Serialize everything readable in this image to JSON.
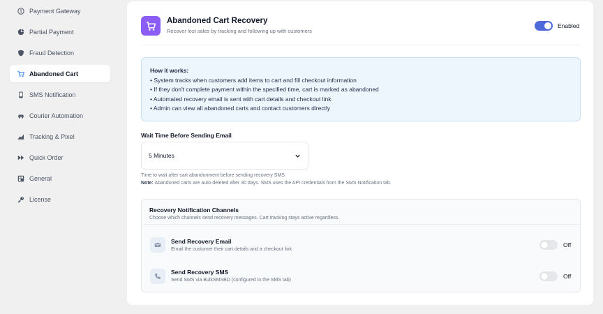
{
  "sidebar": {
    "items": [
      {
        "label": "Payment Gateway",
        "icon": "dollar-icon"
      },
      {
        "label": "Partial Payment",
        "icon": "pie-chart-icon"
      },
      {
        "label": "Fraud Detection",
        "icon": "shield-icon"
      },
      {
        "label": "Abandoned Cart",
        "icon": "cart-icon",
        "active": true
      },
      {
        "label": "SMS Notification",
        "icon": "phone-icon"
      },
      {
        "label": "Courier Automation",
        "icon": "truck-icon"
      },
      {
        "label": "Tracking & Pixel",
        "icon": "chart-icon"
      },
      {
        "label": "Quick Order",
        "icon": "fast-forward-icon"
      },
      {
        "label": "General",
        "icon": "grid-icon"
      },
      {
        "label": "License",
        "icon": "key-icon"
      }
    ]
  },
  "header": {
    "title": "Abandoned Cart Recovery",
    "subtitle": "Recover lost sales by tracking and following up with customers",
    "toggle_label": "Enabled",
    "enabled": true
  },
  "info": {
    "title": "How it works:",
    "lines": [
      "• System tracks when customers add items to cart and fill checkout information",
      "• If they don't complete payment within the specified time, cart is marked as abandoned",
      "• Automated recovery email is sent with cart details and checkout link",
      "• Admin can view all abandoned carts and contact customers directly"
    ]
  },
  "wait_time": {
    "label": "Wait Time Before Sending Email",
    "value": "5 Minutes",
    "help": "Time to wait after cart abandonment before sending recovery SMS.",
    "note_label": "Note:",
    "note": " Abandoned carts are auto-deleted after 30 days. SMS uses the API credentials from the SMS Notification tab."
  },
  "channels": {
    "title": "Recovery Notification Channels",
    "subtitle": "Choose which channels send recovery messages. Cart tracking stays active regardless.",
    "items": [
      {
        "title": "Send Recovery Email",
        "subtitle": "Email the customer their cart details and a checkout link",
        "state_label": "Off",
        "enabled": false,
        "icon": "mail-icon"
      },
      {
        "title": "Send Recovery SMS",
        "subtitle": "Send SMS via BulkSMSBD (configured in the SMS tab)",
        "state_label": "Off",
        "enabled": false,
        "icon": "phone-icon"
      }
    ]
  },
  "colors": {
    "accent": "#4f6ad9",
    "header_icon_bg": "#8b5cf6",
    "info_bg": "#eef6fd"
  }
}
